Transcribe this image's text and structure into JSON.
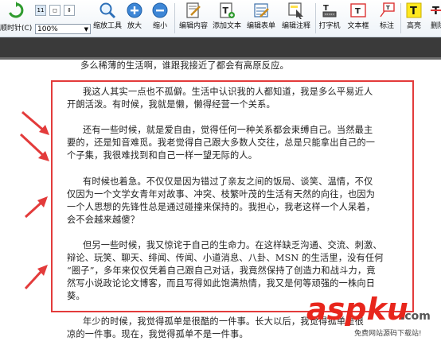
{
  "toolbar": {
    "items": [
      {
        "label": "顺时针(C)",
        "icon": "rotate-clockwise-icon"
      },
      {
        "label": "缩放工具",
        "icon": "zoom-tool-icon"
      },
      {
        "label": "放大",
        "icon": "zoom-in-icon"
      },
      {
        "label": "缩小",
        "icon": "zoom-out-icon"
      },
      {
        "label": "编辑内容",
        "icon": "edit-content-icon"
      },
      {
        "label": "添加文本",
        "icon": "add-text-icon"
      },
      {
        "label": "编辑表单",
        "icon": "edit-form-icon"
      },
      {
        "label": "编辑注释",
        "icon": "edit-annotation-icon"
      },
      {
        "label": "打字机",
        "icon": "typewriter-icon"
      },
      {
        "label": "文本框",
        "icon": "textbox-icon"
      },
      {
        "label": "标注",
        "icon": "callout-icon"
      },
      {
        "label": "高亮",
        "icon": "highlight-icon"
      },
      {
        "label": "删除",
        "icon": "strikeout-icon"
      }
    ],
    "zoom_value": "100%",
    "view_buttons": [
      "11",
      "◻",
      "⇕"
    ]
  },
  "document": {
    "top_line": "多么稀薄的生活啊，谁跟我接近了都会有高原反应。",
    "paragraphs": [
      {
        "lines": [
          "我这人其实一点也不孤僻。生活中认识我的人都知道，我是多么平易近人",
          "开朗活泼。有时候，我就是懒，懒得经营一个关系。"
        ]
      },
      {
        "lines": [
          "还有一些时候，就是爱自由，觉得任何一种关系都会束缚自己。当然最主",
          "要的，还是知音难觅。我老觉得自己跟大多数人交往，总是只能拿出自己的一",
          "个子集，我很难找到和自己一样一望无际的人。"
        ]
      },
      {
        "lines": [
          "有时候也着急。不仅仅是因为错过了亲友之间的饭局、谈笑、温情，不仅",
          "仅因为一个文学女青年对故事、冲突、枝繁叶茂的生活有天然的向往，也因为",
          "一个人思想的先锋性总是通过碰撞来保持的。我担心，我老这样一个人呆着，",
          "会不会越来越傻？"
        ]
      },
      {
        "lines": [
          "但另一些时候，我又惊诧于自己的生命力。在这样缺乏沟通、交流、刺激、",
          "辩论、玩笑、聊天、绯闻、传闻、小道消息、八卦、MSN 的生活里，没有任何",
          "“圈子”，多年来仅仅凭着自己跟自己对话，我竟然保持了创造力和战斗力，竟",
          "然写小说政论论文博客，而且写得如此饱满热情，我又是何等顽强的一株向日",
          "葵。"
        ]
      }
    ],
    "bottom_lines": [
      "年少的时候，我觉得孤单是很酷的一件事。长大以后，我觉得孤单是很",
      "凉的一件事。现在，我觉得孤单不是一件事。"
    ]
  },
  "watermark": {
    "brand": "aspku",
    "tld": ".com",
    "tagline": "免费网站源码下载站!"
  },
  "colors": {
    "highlight_box": "#e33b3b",
    "arrow": "#e33b3b",
    "watermark_red": "#e8261c",
    "band": "#3a3a3a"
  }
}
